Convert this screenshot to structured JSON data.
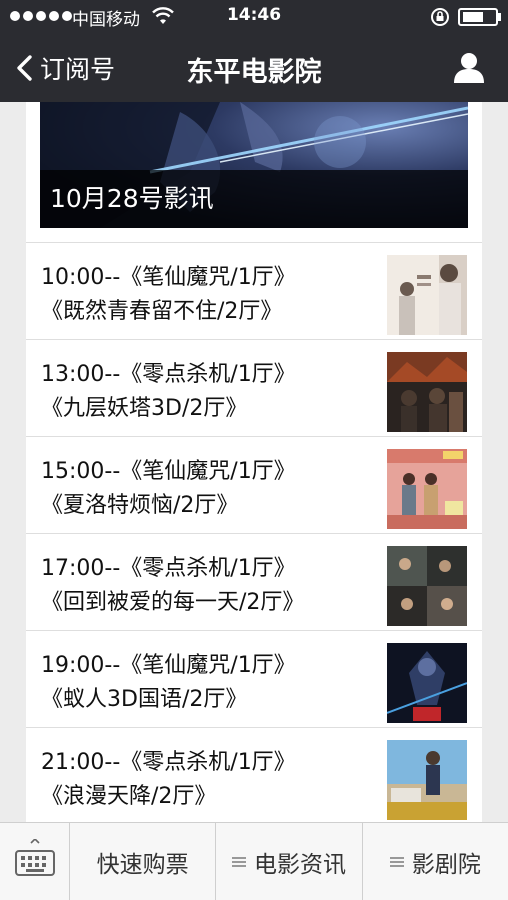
{
  "status_bar": {
    "carrier": "中国移动",
    "time": "14:46"
  },
  "nav": {
    "back_label": "订阅号",
    "title": "东平电影院"
  },
  "article": {
    "caption": "10月28号影讯",
    "rows": [
      {
        "line1": "10:00--《笔仙魔咒/1厅》",
        "line2": "《既然青春留不住/2厅》"
      },
      {
        "line1": "13:00--《零点杀机/1厅》",
        "line2": "《九层妖塔3D/2厅》"
      },
      {
        "line1": "15:00--《笔仙魔咒/1厅》",
        "line2": "《夏洛特烦恼/2厅》"
      },
      {
        "line1": "17:00--《零点杀机/1厅》",
        "line2": "《回到被爱的每一天/2厅》"
      },
      {
        "line1": "19:00--《笔仙魔咒/1厅》",
        "line2": "《蚁人3D国语/2厅》"
      },
      {
        "line1": "21:00--《零点杀机/1厅》",
        "line2": "《浪漫天降/2厅》"
      }
    ]
  },
  "menu": {
    "items": [
      {
        "label": "快速购票"
      },
      {
        "label": "电影资讯"
      },
      {
        "label": "影剧院"
      }
    ]
  },
  "colors": {
    "nav_bg": "#2b2c31",
    "menu_bg": "#f7f7f7",
    "page_bg": "#ececec"
  },
  "icons": {
    "back": "chevron-left-icon",
    "profile": "person-icon",
    "keyboard": "keyboard-icon",
    "menu": "list-icon"
  }
}
